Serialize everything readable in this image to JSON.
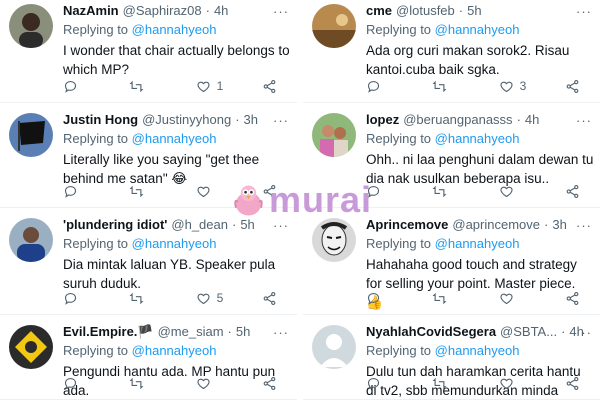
{
  "replying_label": "Replying to",
  "mention": "@hannahyeoh",
  "watermark": {
    "text": "murai",
    "color": "#c89bd8"
  },
  "colors": {
    "link": "#1d9bf0",
    "muted": "#536471",
    "text": "#0f1419"
  },
  "left_column": [
    {
      "name": "NazAmin",
      "handle": "@Saphiraz08",
      "time": "4h",
      "text": "I wonder that chair actually belongs to which MP?",
      "reply_count": "",
      "retweet_count": "",
      "like_count": "1",
      "avatar": "person-dark-avatar"
    },
    {
      "name": "Justin Hong",
      "handle": "@Justinyyhong",
      "time": "3h",
      "text": "Literally like you saying \"get thee behind me satan\" 😂",
      "reply_count": "",
      "retweet_count": "",
      "like_count": "",
      "avatar": "black-flag-avatar"
    },
    {
      "name": "'plundering idiot'",
      "handle": "@h_dean",
      "time": "5h",
      "text": "Dia mintak laluan YB. Speaker pula suruh duduk.",
      "reply_count": "",
      "retweet_count": "",
      "like_count": "5",
      "avatar": "person-blue-avatar"
    },
    {
      "name": "Evil.Empire.🏴",
      "handle": "@me_siam",
      "time": "5h",
      "text": "Pengundi hantu ada. MP hantu pun ada.",
      "reply_count": "",
      "retweet_count": "",
      "like_count": "",
      "avatar": "yellow-emblem-avatar"
    }
  ],
  "right_column": [
    {
      "name": "cme",
      "handle": "@lotusfeb",
      "time": "5h",
      "text": "Ada org curi makan sorok2. Risau kantoi.cuba baik sgka.",
      "reply_count": "",
      "retweet_count": "",
      "like_count": "3",
      "avatar": "sepia-landscape-avatar"
    },
    {
      "name": "lopez",
      "handle": "@beruangpanasss",
      "time": "4h",
      "text": "Ohh.. ni laa penghuni dalam dewan tu dia nak usulkan beberapa isu..",
      "reply_count": "",
      "retweet_count": "",
      "like_count": "",
      "avatar": "outdoor-people-avatar"
    },
    {
      "name": "Aprincemove",
      "handle": "@aprincemove",
      "time": "3h",
      "text": "Hahahaha good touch and strategy for selling your point. Master piece. 👍",
      "reply_count": "",
      "retweet_count": "",
      "like_count": "",
      "avatar": "mask-avatar"
    },
    {
      "name": "NyahlahCovidSegera",
      "handle": "@SBTA...",
      "time": "4h",
      "text": "Dulu tun dah haramkan cerita hantu di tv2, sbb memundurkan minda rakyat",
      "reply_count": "",
      "retweet_count": "",
      "like_count": "",
      "avatar": "default-avatar"
    }
  ]
}
